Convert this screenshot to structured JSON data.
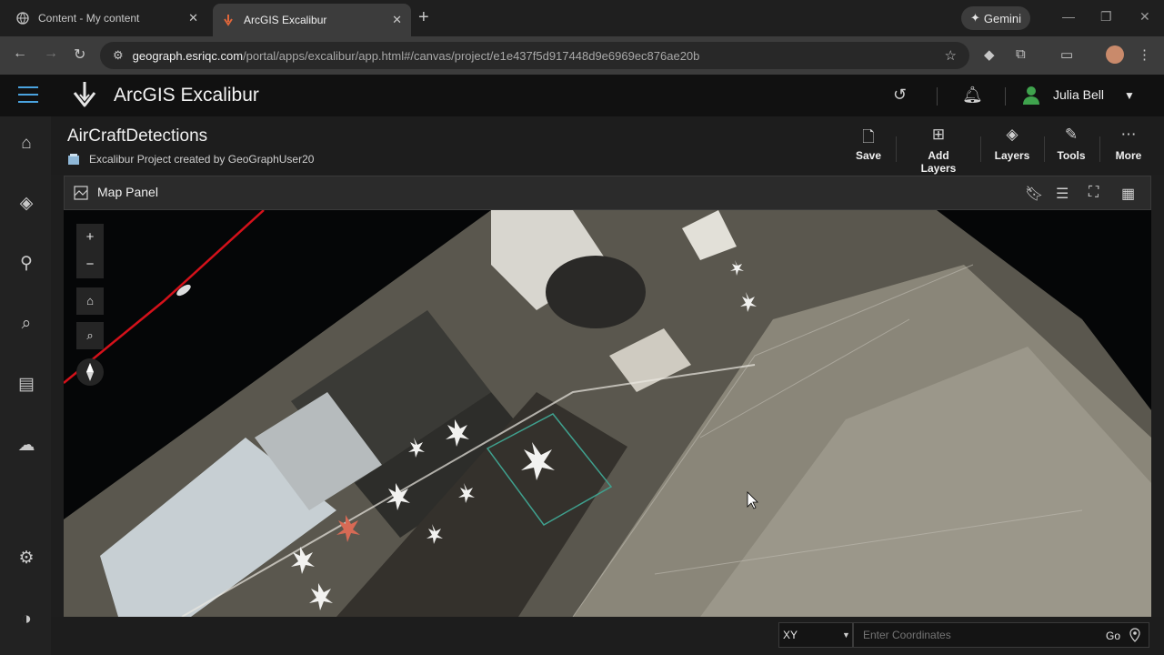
{
  "browser": {
    "tabs": [
      {
        "title": "Content - My content",
        "active": false
      },
      {
        "title": "ArcGIS Excalibur",
        "active": true
      }
    ],
    "new_tab": "+",
    "gemini_label": "Gemini",
    "url_host": "geograph.esriqc.com",
    "url_path": "/portal/apps/excalibur/app.html#/canvas/project/e1e437f5d917448d9e6969ec876ae20b"
  },
  "app": {
    "title": "ArcGIS Excalibur",
    "user_name": "Julia Bell",
    "accent": "#4aa3df"
  },
  "project": {
    "title": "AirCraftDetections",
    "subtitle": "Excalibur Project created by GeoGraphUser20",
    "actions": [
      {
        "label": "Save",
        "icon": "save-icon"
      },
      {
        "label": "Add Layers",
        "icon": "add-layers-icon"
      },
      {
        "label": "Layers",
        "icon": "layers-icon"
      },
      {
        "label": "Tools",
        "icon": "tools-icon"
      },
      {
        "label": "More",
        "icon": "more-icon"
      }
    ]
  },
  "map_panel": {
    "title": "Map Panel",
    "controls": {
      "zoom_in": "+",
      "zoom_out": "−"
    }
  },
  "coords": {
    "format": "XY",
    "placeholder": "Enter Coordinates",
    "go_label": "Go"
  }
}
